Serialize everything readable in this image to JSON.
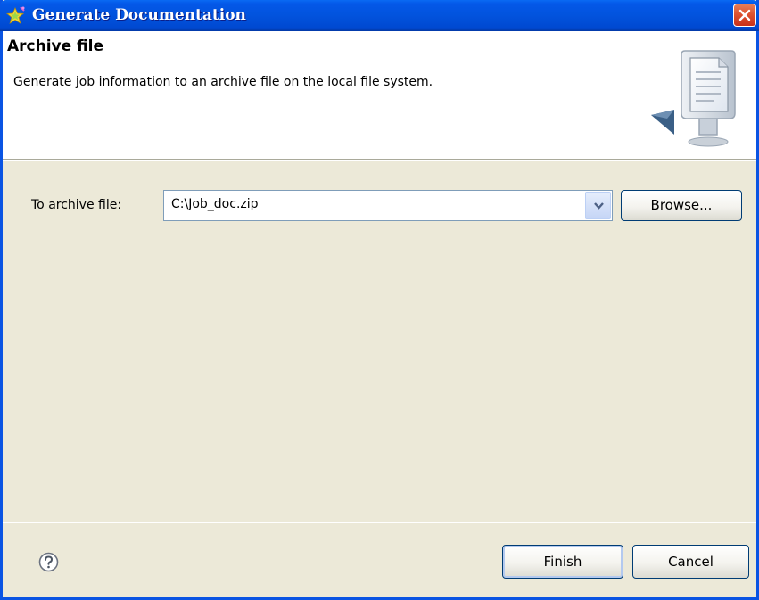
{
  "window": {
    "title": "Generate Documentation",
    "title_icon": "wizard-star-icon",
    "close_icon": "close-icon"
  },
  "banner": {
    "title": "Archive file",
    "description": "Generate job information to an archive file on the local file system.",
    "graphic": "export-document-icon"
  },
  "form": {
    "archive_label": "To archive file:",
    "archive_value": "C:\\Job_doc.zip",
    "dropdown_icon": "chevron-down-icon",
    "browse_label": "Browse..."
  },
  "footer": {
    "help_icon": "help-icon",
    "finish_label": "Finish",
    "cancel_label": "Cancel"
  },
  "colors": {
    "titlebar_blue": "#0253dd",
    "dialog_background": "#ece9d8",
    "close_red": "#dd5331"
  }
}
